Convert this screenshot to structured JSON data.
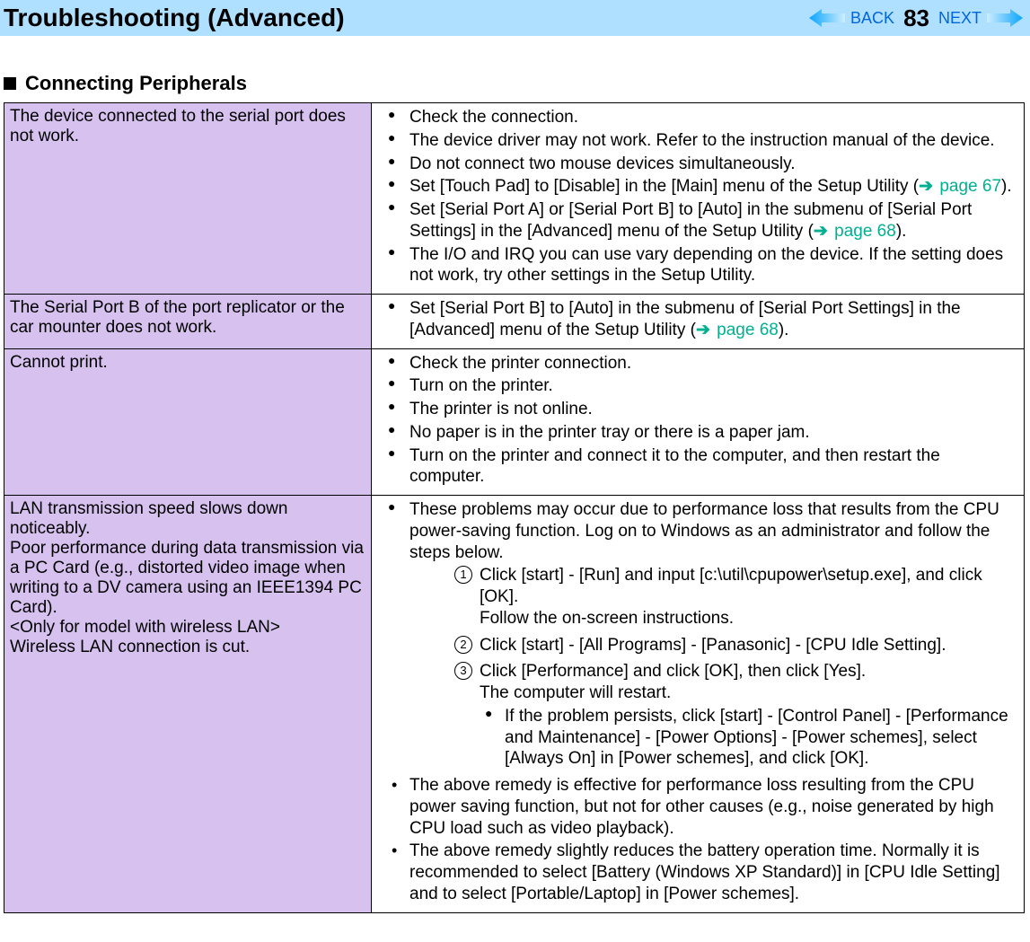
{
  "header": {
    "title": "Troubleshooting (Advanced)",
    "back_label": "BACK",
    "next_label": "NEXT",
    "page_number": "83"
  },
  "section": {
    "heading": "Connecting Peripherals"
  },
  "rows": [
    {
      "issue": "The device connected to the serial port does not work.",
      "bullets": [
        "Check the connection.",
        "The device driver may not work. Refer to the instruction manual of the device.",
        "Do not connect two mouse devices simultaneously.",
        [
          "Set [Touch Pad] to [Disable] in the [Main] menu of the Setup Utility (",
          " page 67",
          ")."
        ],
        [
          "Set [Serial Port A] or [Serial Port B] to [Auto] in the submenu of [Serial Port Settings] in the [Advanced] menu of the Setup Utility (",
          " page 68",
          ")."
        ],
        "The I/O and IRQ you can use vary depending on the device. If the setting does not work, try other settings in the Setup Utility."
      ]
    },
    {
      "issue": "The Serial Port B of the port replicator or the car mounter does not work.",
      "bullets": [
        [
          "Set [Serial Port B] to [Auto] in the submenu of [Serial Port Settings] in the [Advanced] menu of the Setup Utility (",
          " page 68",
          ")."
        ]
      ]
    },
    {
      "issue": "Cannot print.",
      "bullets": [
        "Check the printer connection.",
        "Turn on the printer.",
        "The printer is not online.",
        "No paper is in the printer tray or there is a paper jam.",
        "Turn on the printer and connect it to the computer, and then restart the computer."
      ]
    },
    {
      "issue": "LAN transmission speed slows down noticeably.\nPoor performance during data transmission via a PC Card (e.g., distorted video image when writing to a DV camera using an IEEE1394 PC Card).\n<Only for model with wireless LAN>\nWireless LAN connection is cut.",
      "intro": "These problems may occur due to performance loss that results from the CPU power-saving function. Log on to Windows as an administrator and follow the steps below.",
      "steps": [
        {
          "text": "Click [start] - [Run] and input [c:\\util\\cpupower\\setup.exe], and click [OK].",
          "after": "Follow the on-screen instructions."
        },
        {
          "text": "Click [start] - [All Programs] - [Panasonic] - [CPU Idle Setting]."
        },
        {
          "text": "Click [Performance] and click [OK], then click [Yes].",
          "after": "The computer will restart.",
          "sub": "If the problem persists, click [start] - [Control Panel] - [Performance and Maintenance] - [Power Options] - [Power schemes], select [Always On] in [Power schemes], and click [OK]."
        }
      ],
      "notes": [
        "The above remedy is effective for performance loss resulting from the CPU power saving function, but not for other causes (e.g., noise generated by high CPU load such as video playback).",
        "The above remedy slightly reduces the battery operation time. Normally it is recommended to select [Battery (Windows XP Standard)] in [CPU Idle Setting] and to select [Portable/Laptop] in [Power schemes]."
      ]
    }
  ]
}
